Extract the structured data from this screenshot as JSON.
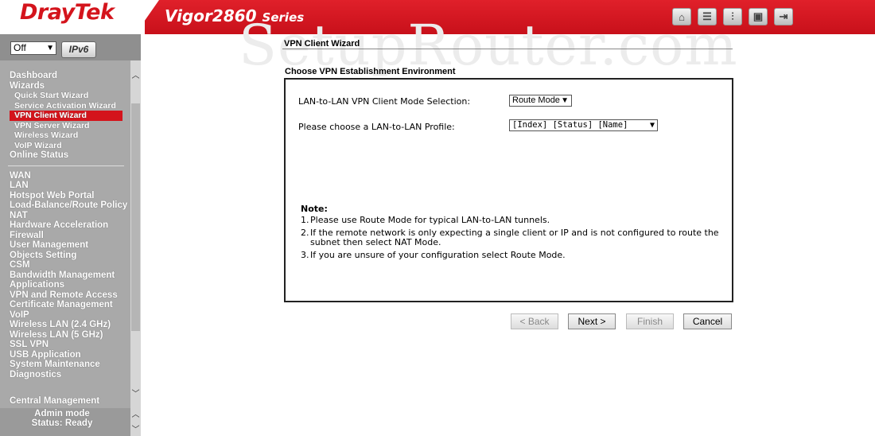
{
  "header": {
    "brand": "DrayTek",
    "model": "Vigor2860",
    "series": "Series",
    "icons": [
      "home-icon",
      "list-icon",
      "settings-sliders-icon",
      "save-icon",
      "logout-icon"
    ]
  },
  "sidebar": {
    "mode_select": "Off",
    "ipv6_label": "IPv6",
    "menu_group1": [
      {
        "label": "Dashboard",
        "type": "top"
      },
      {
        "label": "Wizards",
        "type": "top"
      },
      {
        "label": "Quick Start Wizard",
        "type": "sub"
      },
      {
        "label": "Service Activation Wizard",
        "type": "sub"
      },
      {
        "label": "VPN Client Wizard",
        "type": "sub",
        "active": true
      },
      {
        "label": "VPN Server Wizard",
        "type": "sub"
      },
      {
        "label": "Wireless Wizard",
        "type": "sub"
      },
      {
        "label": "VoIP Wizard",
        "type": "sub"
      },
      {
        "label": "Online Status",
        "type": "top"
      }
    ],
    "menu_group2": [
      "WAN",
      "LAN",
      "Hotspot Web Portal",
      "Load-Balance/Route Policy",
      "NAT",
      "Hardware Acceleration",
      "Firewall",
      "User Management",
      "Objects Setting",
      "CSM",
      "Bandwidth Management",
      "Applications",
      "VPN and Remote Access",
      "Certificate Management",
      "VoIP",
      "Wireless LAN (2.4 GHz)",
      "Wireless LAN (5 GHz)",
      "SSL VPN",
      "USB Application",
      "System Maintenance",
      "Diagnostics"
    ],
    "central_management": "Central Management",
    "status_mode": "Admin mode",
    "status_ready": "Status: Ready"
  },
  "main": {
    "watermark": "SetupRouter.com",
    "page_title": "VPN Client Wizard",
    "section_title": "Choose VPN Establishment Environment",
    "mode_label": "LAN-to-LAN VPN Client Mode Selection:",
    "mode_value": "Route Mode",
    "profile_label": "Please choose a LAN-to-LAN Profile:",
    "profile_value": "[Index] [Status] [Name]",
    "note_title": "Note:",
    "notes": [
      {
        "num": "1.",
        "text": "Please use Route Mode for typical LAN-to-LAN tunnels."
      },
      {
        "num": "2.",
        "text": "If the remote network is only expecting a single client or IP and is not configured to route the subnet then select NAT Mode."
      },
      {
        "num": "3.",
        "text": "If you are unsure of your configuration select Route Mode."
      }
    ],
    "buttons": {
      "back": "< Back",
      "next": "Next >",
      "finish": "Finish",
      "cancel": "Cancel"
    }
  }
}
